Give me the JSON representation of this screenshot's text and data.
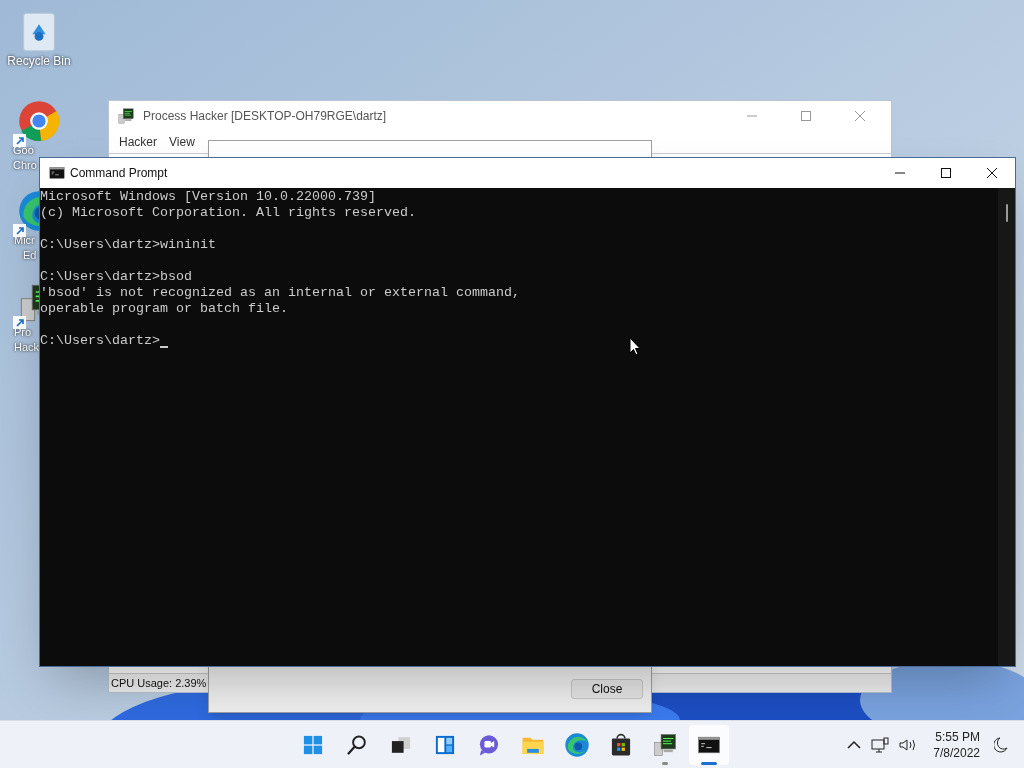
{
  "desktop_icons": [
    {
      "kind": "recycle",
      "lines": [
        "Recycle Bin"
      ]
    },
    {
      "kind": "chrome",
      "lines": [
        "Goo",
        "Chro"
      ]
    },
    {
      "kind": "edge",
      "lines": [
        "Micr",
        "Ed"
      ]
    },
    {
      "kind": "hacker",
      "lines": [
        "Pro",
        "Hack"
      ]
    }
  ],
  "process_hacker": {
    "title": "Process Hacker [DESKTOP-OH79RGE\\dartz]",
    "menu": [
      "Hacker",
      "View"
    ],
    "status": "CPU Usage: 2.39%"
  },
  "properties": {
    "button": "Close"
  },
  "console": {
    "title": "Command Prompt",
    "lines": [
      {
        "kind": "text",
        "text": "Microsoft Windows [Version 10.0.22000.739]"
      },
      {
        "kind": "text",
        "text": "(c) Microsoft Corporation. All rights reserved."
      },
      {
        "kind": "blank"
      },
      {
        "kind": "text",
        "text": "C:\\Users\\dartz>wininit"
      },
      {
        "kind": "blank"
      },
      {
        "kind": "text",
        "text": "C:\\Users\\dartz>bsod"
      },
      {
        "kind": "text",
        "text": "'bsod' is not recognized as an internal or external command,"
      },
      {
        "kind": "text",
        "text": "operable program or batch file."
      },
      {
        "kind": "blank"
      },
      {
        "kind": "text",
        "text": "C:\\Users\\dartz>"
      }
    ]
  },
  "taskbar": {
    "apps": [
      {
        "kind": "start",
        "running": false,
        "selected": false
      },
      {
        "kind": "search",
        "running": false,
        "selected": false
      },
      {
        "kind": "taskview",
        "running": false,
        "selected": false
      },
      {
        "kind": "widgets",
        "running": false,
        "selected": false
      },
      {
        "kind": "chat",
        "running": false,
        "selected": false
      },
      {
        "kind": "explorer",
        "running": false,
        "selected": false
      },
      {
        "kind": "edge",
        "running": false,
        "selected": false
      },
      {
        "kind": "store",
        "running": false,
        "selected": false
      },
      {
        "kind": "hacker",
        "running": true,
        "selected": false
      },
      {
        "kind": "terminal",
        "running": true,
        "selected": true
      }
    ],
    "time": "5:55 PM",
    "date": "7/8/2022"
  }
}
